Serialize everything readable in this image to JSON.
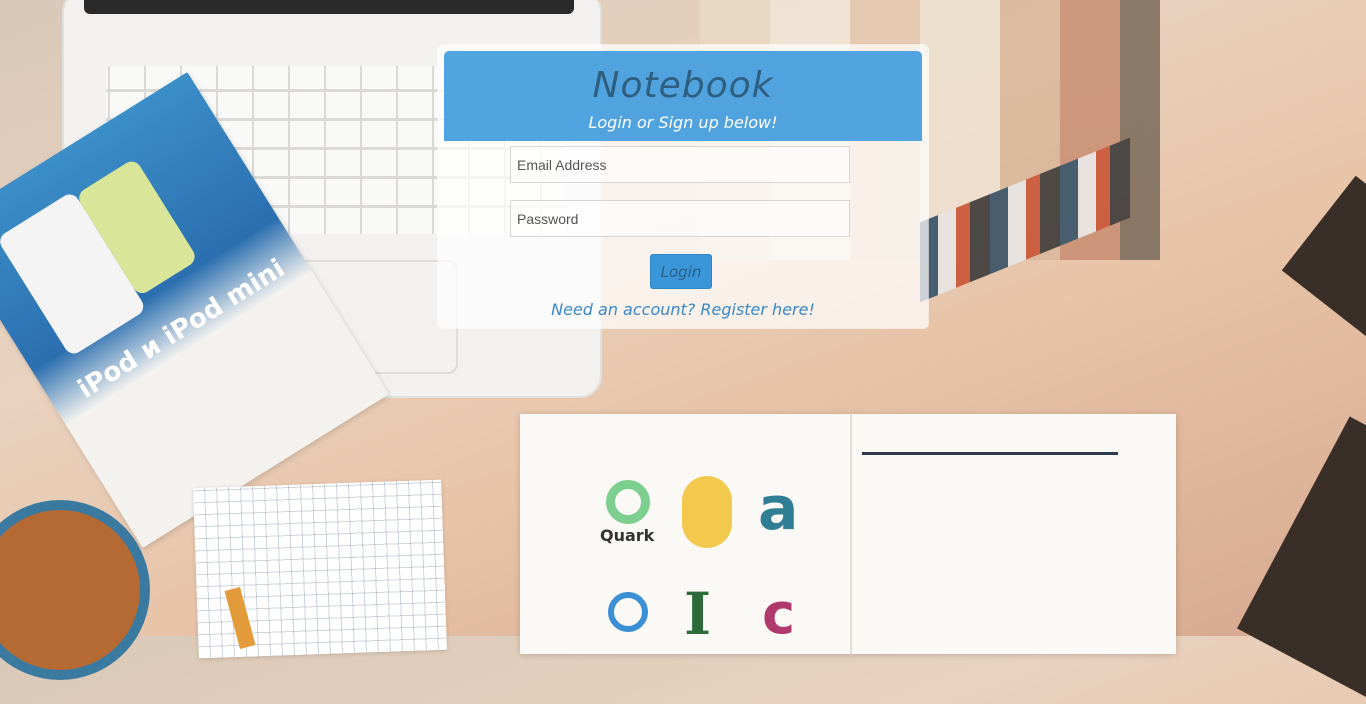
{
  "panel": {
    "brand": "Notebook",
    "tagline": "Login or Sign up below!",
    "email_placeholder": "Email Address",
    "password_placeholder": "Password",
    "login_label": "Login",
    "register_link": "Need an account? Register here!"
  },
  "background": {
    "booklet_title": "iPod и iPod mini",
    "logo_quark": "Quark"
  },
  "colors": {
    "header": "#3897dc",
    "brand_text": "#2f5f80",
    "link": "#3a88c6"
  }
}
